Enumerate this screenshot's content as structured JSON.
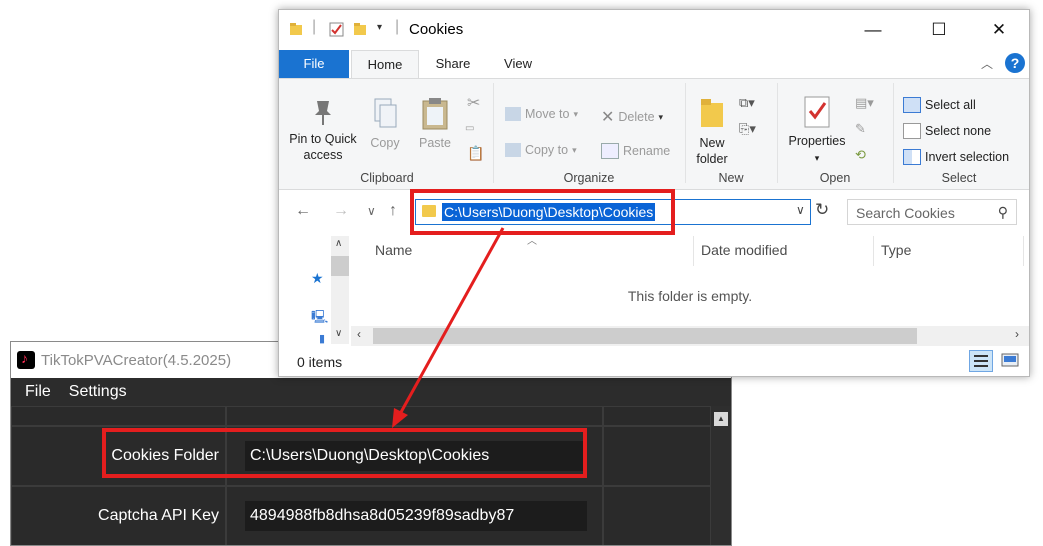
{
  "app": {
    "title": "TikTokPVACreator(4.5.2025)",
    "menu": [
      "File",
      "Settings"
    ],
    "fields": [
      {
        "label": "Cookies Folder",
        "value": "C:\\Users\\Duong\\Desktop\\Cookies"
      },
      {
        "label": "Captcha API Key",
        "value": "4894988fb8dhsa8d05239f89sadby87"
      }
    ]
  },
  "explorer": {
    "title": "Cookies",
    "tabs": {
      "file": "File",
      "home": "Home",
      "share": "Share",
      "view": "View"
    },
    "help": "?",
    "ribbon": {
      "clipboard": {
        "label": "Clipboard",
        "pin": "Pin to Quick access",
        "copy": "Copy",
        "paste": "Paste"
      },
      "organize": {
        "label": "Organize",
        "move_to": "Move to",
        "copy_to": "Copy to",
        "delete": "Delete",
        "rename": "Rename"
      },
      "new": {
        "label": "New",
        "new_folder": "New folder"
      },
      "open": {
        "label": "Open",
        "properties": "Properties"
      },
      "select": {
        "label": "Select",
        "select_all": "Select all",
        "select_none": "Select none",
        "invert": "Invert selection"
      }
    },
    "address": "C:\\Users\\Duong\\Desktop\\Cookies",
    "search_placeholder": "Search Cookies",
    "columns": {
      "name": "Name",
      "date_modified": "Date modified",
      "type": "Type"
    },
    "empty_message": "This folder is empty.",
    "status": "0 items"
  },
  "colors": {
    "highlight": "#e41e1e",
    "accent": "#1a73d1",
    "app_bg": "#1f1f1f"
  }
}
